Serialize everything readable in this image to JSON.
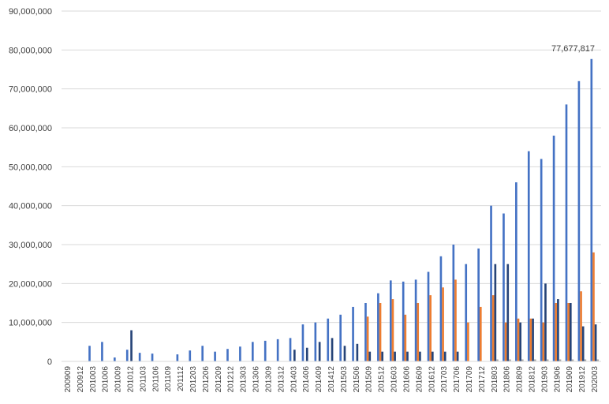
{
  "chart_data": {
    "type": "bar",
    "title": "",
    "xlabel": "",
    "ylabel": "",
    "ylim": [
      0,
      90000000
    ],
    "y_ticks": [
      "0",
      "10,000,000",
      "20,000,000",
      "30,000,000",
      "40,000,000",
      "50,000,000",
      "60,000,000",
      "70,000,000",
      "80,000,000",
      "90,000,000"
    ],
    "grid": "horizontal",
    "legend": "none",
    "colors": {
      "blue": "#4472C4",
      "orange": "#ED7D31",
      "dark": "#264478",
      "gray": "#A5A5A5",
      "gold": "#FFC000",
      "axis": "#D9D9D9",
      "grid": "#D9D9D9"
    },
    "categories": [
      "200909",
      "200912",
      "201003",
      "201006",
      "201009",
      "201012",
      "201103",
      "201106",
      "201109",
      "201112",
      "201203",
      "201206",
      "201209",
      "201212",
      "201303",
      "201306",
      "201309",
      "201312",
      "201403",
      "201406",
      "201409",
      "201412",
      "201503",
      "201506",
      "201509",
      "201512",
      "201603",
      "201606",
      "201609",
      "201612",
      "201703",
      "201706",
      "201709",
      "201712",
      "201803",
      "201806",
      "201809",
      "201812",
      "201903",
      "201906",
      "201909",
      "201912",
      "202003"
    ],
    "series": [
      {
        "color": "blue",
        "values": [
          0,
          0,
          4000000,
          5000000,
          1000000,
          3000000,
          2200000,
          2000000,
          0,
          1800000,
          2800000,
          4000000,
          2500000,
          3200000,
          3800000,
          5000000,
          5300000,
          5700000,
          6000000,
          9500000,
          10000000,
          11000000,
          12000000,
          14000000,
          15000000,
          17500000,
          20800000,
          20500000,
          21000000,
          23000000,
          27000000,
          30000000,
          25000000,
          29000000,
          40000000,
          38000000,
          46000000,
          54000000,
          52000000,
          58000000,
          66000000,
          72000000,
          77677817
        ]
      },
      {
        "color": "orange",
        "values": [
          0,
          0,
          0,
          0,
          0,
          0,
          0,
          0,
          0,
          0,
          0,
          0,
          0,
          0,
          0,
          0,
          0,
          0,
          0,
          0,
          0,
          0,
          0,
          0,
          11500000,
          15000000,
          16000000,
          12000000,
          15000000,
          17000000,
          19000000,
          21000000,
          10000000,
          14000000,
          17000000,
          10000000,
          11000000,
          11000000,
          10000000,
          15000000,
          15000000,
          18000000,
          28000000
        ]
      },
      {
        "color": "dark",
        "values": [
          0,
          0,
          0,
          0,
          0,
          8000000,
          0,
          0,
          0,
          0,
          0,
          0,
          0,
          0,
          0,
          0,
          0,
          0,
          3000000,
          3500000,
          5000000,
          6000000,
          4000000,
          4500000,
          2500000,
          2500000,
          2500000,
          2500000,
          2500000,
          2500000,
          2500000,
          2500000,
          0,
          0,
          25000000,
          25000000,
          10000000,
          11000000,
          20000000,
          16000000,
          15000000,
          9000000,
          9500000
        ]
      },
      {
        "color": "gray",
        "values": [
          0,
          0,
          0,
          0,
          0,
          0,
          0,
          0,
          0,
          0,
          0,
          0,
          0,
          0,
          0,
          0,
          0,
          0,
          0,
          0,
          0,
          0,
          0,
          0,
          0,
          0,
          0,
          0,
          0,
          0,
          0,
          0,
          0,
          0,
          500000,
          500000,
          500000,
          500000,
          500000,
          500000,
          500000,
          500000,
          500000
        ]
      }
    ],
    "annotations": [
      {
        "text": "77,677,817",
        "category": "202003",
        "value": 77677817
      }
    ]
  }
}
